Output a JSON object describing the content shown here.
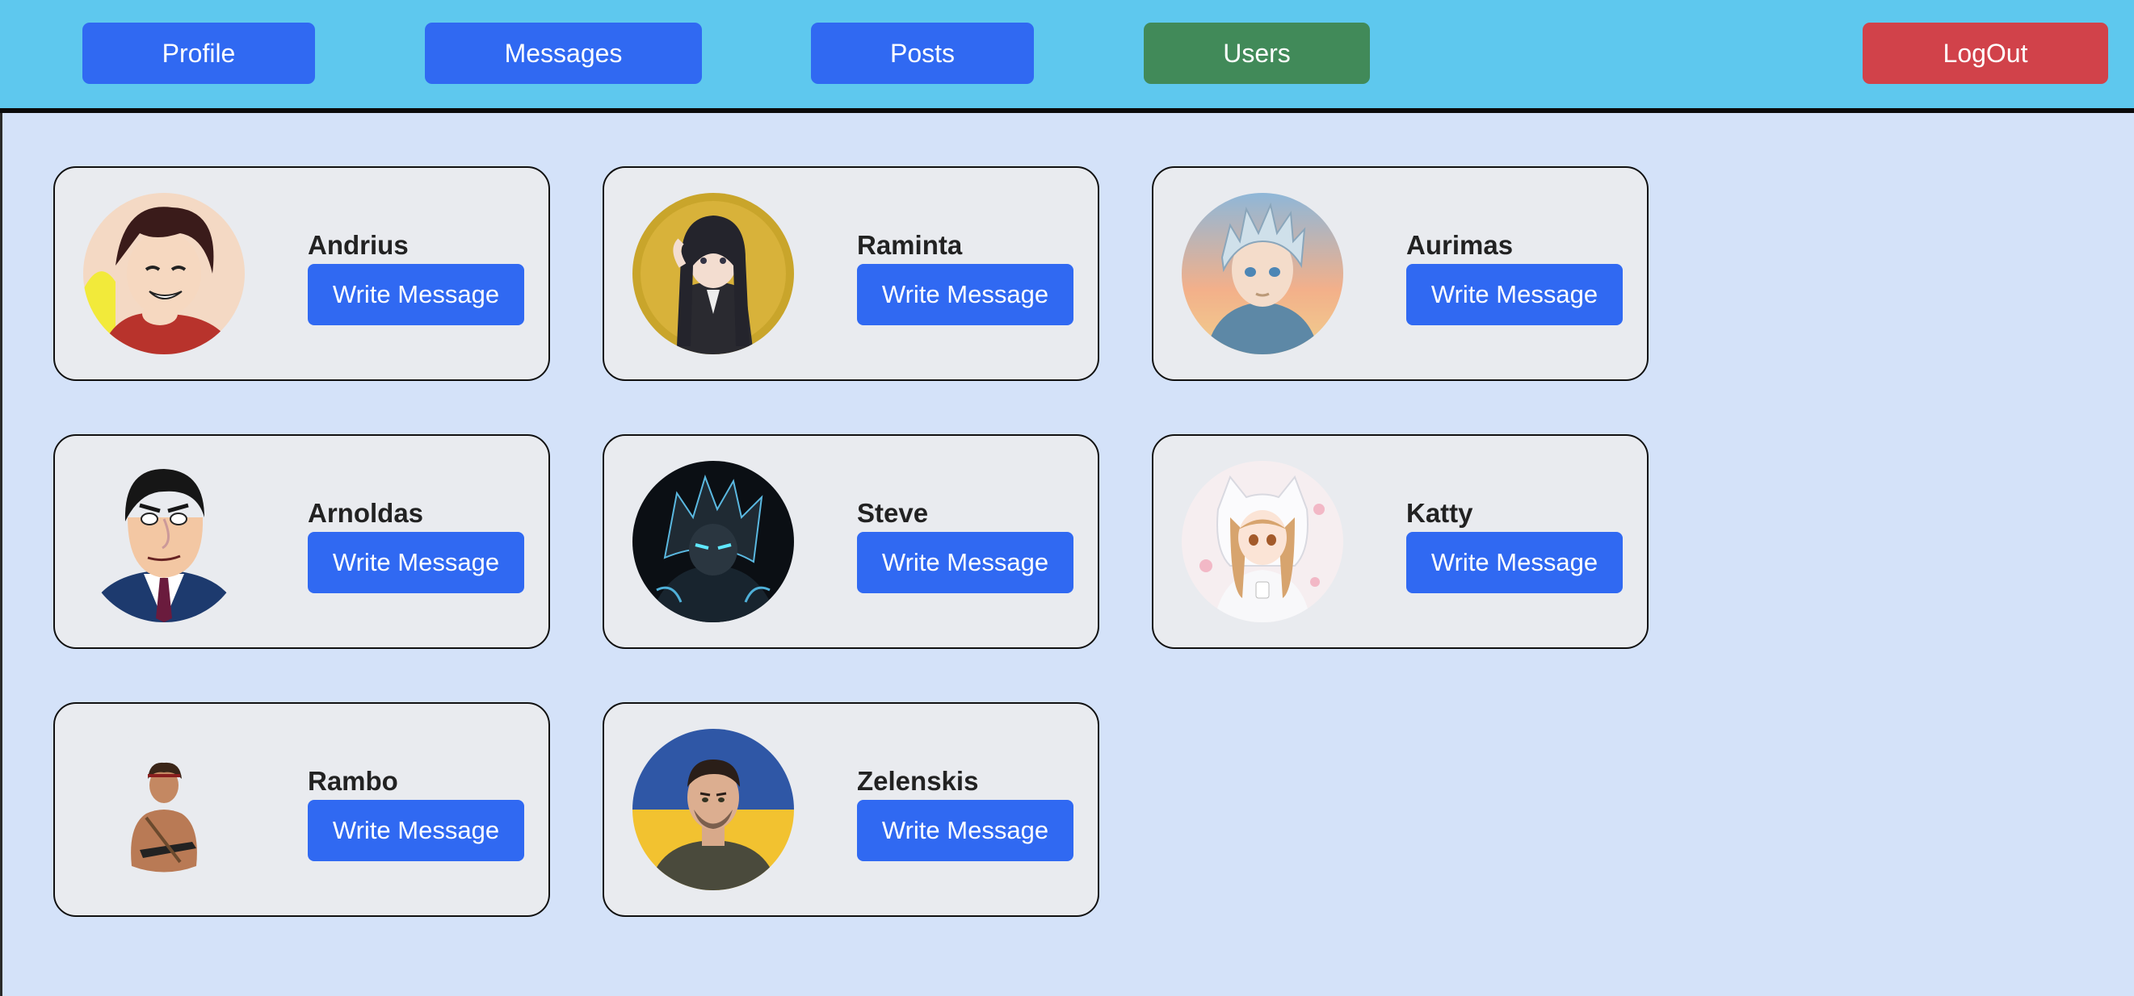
{
  "nav": {
    "profile_label": "Profile",
    "messages_label": "Messages",
    "posts_label": "Posts",
    "users_label": "Users",
    "logout_label": "LogOut"
  },
  "colors": {
    "header_bg": "#5ec8ee",
    "page_bg": "#d4e2f9",
    "nav_button": "#3069f2",
    "active_nav_button": "#418a59",
    "logout_button": "#d1424a",
    "card_bg": "#e9ebef"
  },
  "users": [
    {
      "name": "Andrius",
      "button_label": "Write Message",
      "avatar_icon": "anime-boy-avatar"
    },
    {
      "name": "Raminta",
      "button_label": "Write Message",
      "avatar_icon": "anime-girl-avatar"
    },
    {
      "name": "Aurimas",
      "button_label": "Write Message",
      "avatar_icon": "anime-boy-hoodie-avatar"
    },
    {
      "name": "Arnoldas",
      "button_label": "Write Message",
      "avatar_icon": "cartoon-businessman-avatar"
    },
    {
      "name": "Steve",
      "button_label": "Write Message",
      "avatar_icon": "dark-hero-avatar"
    },
    {
      "name": "Katty",
      "button_label": "Write Message",
      "avatar_icon": "anime-cat-girl-avatar"
    },
    {
      "name": "Rambo",
      "button_label": "Write Message",
      "avatar_icon": "soldier-avatar"
    },
    {
      "name": "Zelenskis",
      "button_label": "Write Message",
      "avatar_icon": "man-portrait-avatar"
    }
  ]
}
